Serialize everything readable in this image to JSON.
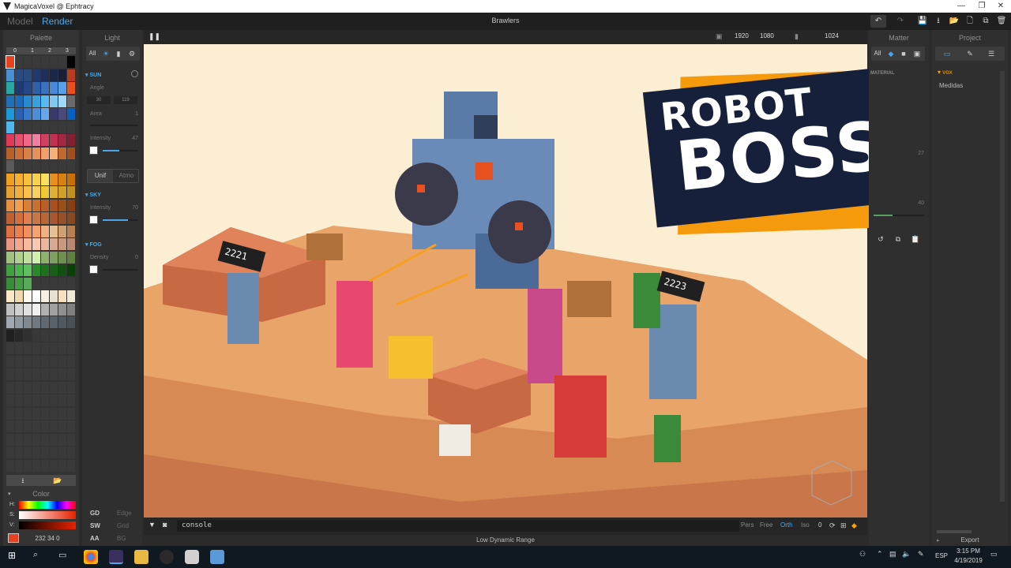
{
  "window": {
    "title": "MagicaVoxel @ Ephtracy",
    "minimize": "—",
    "restore": "❐",
    "close": "✕"
  },
  "modes": {
    "model": "Model",
    "render": "Render"
  },
  "document": {
    "title": "Brawlers"
  },
  "toolbar": {
    "undo": "↶",
    "redo": "↷",
    "save": "💾",
    "export": "⭳",
    "open": "📂",
    "new": "🗋",
    "copy": "⧉",
    "delete": "🗑"
  },
  "palette": {
    "heading": "Palette",
    "pages": [
      "0",
      "1",
      "2",
      "3"
    ],
    "colors": [
      [
        "#e8411f",
        "#3a3a3a",
        "#3a3a3a",
        "#3a3a3a",
        "#3a3a3a",
        "#3a3a3a",
        "#3a3a3a",
        "#050505"
      ],
      [
        "#4a90d0",
        "#2a4b80",
        "#2a4b80",
        "#22386a",
        "#1f2f58",
        "#1b2748",
        "#182038",
        "#b83c22"
      ],
      [
        "#28a8a0",
        "#1f3a70",
        "#27468a",
        "#3060a8",
        "#3a72c0",
        "#4a88d8",
        "#5aa0e8",
        "#e85020"
      ],
      [
        "#2070b8",
        "#1f6ab8",
        "#2a88d0",
        "#3aa0e0",
        "#58b8f0",
        "#80c8f0",
        "#a0d8f8",
        "#6a6a6a"
      ],
      [
        "#1a9ad8",
        "#2a60b0",
        "#3878c8",
        "#4a90d8",
        "#68a8e8",
        "#3a3a6a",
        "#4a4a7a",
        "#0a60c0"
      ],
      [
        "#50b8e8",
        "#3a3a3a",
        "#3a3a3a",
        "#3a3a3a",
        "#3a3a3a",
        "#3a3a3a",
        "#3a3a3a",
        "#3a3a3a"
      ],
      [
        "#e03a5a",
        "#e85070",
        "#f06888",
        "#f080a0",
        "#d04060",
        "#c03050",
        "#a02840",
        "#802030"
      ],
      [
        "#b8602a",
        "#c87038",
        "#d88048",
        "#e89058",
        "#f0a068",
        "#f8b078",
        "#c06a30",
        "#a05020"
      ],
      [
        "#5a5a5a",
        "#3a3a3a",
        "#3a3a3a",
        "#3a3a3a",
        "#3a3a3a",
        "#3a3a3a",
        "#3a3a3a",
        "#3a3a3a"
      ],
      [
        "#f0a020",
        "#f8b030",
        "#f8c040",
        "#f8d050",
        "#f8e060",
        "#e89018",
        "#d88010",
        "#c87008"
      ],
      [
        "#e8a030",
        "#f0b040",
        "#f8c050",
        "#f8d060",
        "#f0c838",
        "#e0b030",
        "#d0a028",
        "#c09020"
      ],
      [
        "#e89040",
        "#f0a050",
        "#d88038",
        "#c87030",
        "#b86028",
        "#a85020",
        "#985018",
        "#884010"
      ],
      [
        "#c06030",
        "#d07040",
        "#e08050",
        "#c87848",
        "#b86838",
        "#a85830",
        "#985028",
        "#884820"
      ],
      [
        "#e07040",
        "#e88050",
        "#f09060",
        "#f8a070",
        "#f0b080",
        "#e8c090",
        "#d0a070",
        "#b88050"
      ],
      [
        "#e89880",
        "#f0a890",
        "#f8b8a0",
        "#f8c8b0",
        "#e8b8a0",
        "#d8a890",
        "#c89880",
        "#b88870"
      ],
      [
        "#a0c080",
        "#b0d090",
        "#c0e0a0",
        "#d0f0b0",
        "#90b070",
        "#80a060",
        "#709050",
        "#608040"
      ],
      [
        "#40a040",
        "#50b050",
        "#60c060",
        "#2a8a2a",
        "#207020",
        "#186018",
        "#105010",
        "#084008"
      ],
      [
        "#3a8a3a",
        "#4a9a4a",
        "#5aaa5a",
        "#3a3a3a",
        "#3a3a3a",
        "#3a3a3a",
        "#3a3a3a",
        "#3a3a3a"
      ],
      [
        "#f8e8c8",
        "#f0d8b0",
        "#fff8f0",
        "#ffffff",
        "#f8f0e0",
        "#e8e0d0",
        "#f8e0c0",
        "#f0e8d8"
      ],
      [
        "#c0c0c0",
        "#d0d0d0",
        "#e0e0e0",
        "#f0f0f0",
        "#b0b0b0",
        "#a0a0a0",
        "#909090",
        "#808080"
      ],
      [
        "#a0a8b0",
        "#9098a0",
        "#808890",
        "#707880",
        "#606870",
        "#586068",
        "#505860",
        "#485058"
      ],
      [
        "#202020",
        "#282828",
        "#303030",
        "#383838",
        "#3a3a3a",
        "#3a3a3a",
        "#3a3a3a",
        "#3a3a3a"
      ],
      [
        "#3a3a3a",
        "#3a3a3a",
        "#3a3a3a",
        "#3a3a3a",
        "#3a3a3a",
        "#3a3a3a",
        "#3a3a3a",
        "#3a3a3a"
      ],
      [
        "#3a3a3a",
        "#3a3a3a",
        "#3a3a3a",
        "#3a3a3a",
        "#3a3a3a",
        "#3a3a3a",
        "#3a3a3a",
        "#3a3a3a"
      ],
      [
        "#3a3a3a",
        "#3a3a3a",
        "#3a3a3a",
        "#3a3a3a",
        "#3a3a3a",
        "#3a3a3a",
        "#3a3a3a",
        "#3a3a3a"
      ],
      [
        "#3a3a3a",
        "#3a3a3a",
        "#3a3a3a",
        "#3a3a3a",
        "#3a3a3a",
        "#3a3a3a",
        "#3a3a3a",
        "#3a3a3a"
      ],
      [
        "#3a3a3a",
        "#3a3a3a",
        "#3a3a3a",
        "#3a3a3a",
        "#3a3a3a",
        "#3a3a3a",
        "#3a3a3a",
        "#3a3a3a"
      ],
      [
        "#3a3a3a",
        "#3a3a3a",
        "#3a3a3a",
        "#3a3a3a",
        "#3a3a3a",
        "#3a3a3a",
        "#3a3a3a",
        "#3a3a3a"
      ],
      [
        "#3a3a3a",
        "#3a3a3a",
        "#3a3a3a",
        "#3a3a3a",
        "#3a3a3a",
        "#3a3a3a",
        "#3a3a3a",
        "#3a3a3a"
      ],
      [
        "#3a3a3a",
        "#3a3a3a",
        "#3a3a3a",
        "#3a3a3a",
        "#3a3a3a",
        "#3a3a3a",
        "#3a3a3a",
        "#3a3a3a"
      ],
      [
        "#3a3a3a",
        "#3a3a3a",
        "#3a3a3a",
        "#3a3a3a",
        "#3a3a3a",
        "#3a3a3a",
        "#3a3a3a",
        "#3a3a3a"
      ],
      [
        "#3a3a3a",
        "#3a3a3a",
        "#3a3a3a",
        "#3a3a3a",
        "#3a3a3a",
        "#3a3a3a",
        "#3a3a3a",
        "#3a3a3a"
      ]
    ],
    "color_heading": "Color",
    "h_label": "H:",
    "s_label": "S:",
    "v_label": "V:",
    "current_color": "#e8411f",
    "rgb_value": "232 34 0"
  },
  "light": {
    "heading": "Light",
    "filter_all": "All",
    "sun": {
      "label": "SUN",
      "angle_label": "Angle",
      "angle_a": "30",
      "angle_b": "119",
      "area_label": "Area",
      "area_value": "1",
      "intensity_label": "Intensity",
      "intensity_value": "47",
      "intensity_level": 0.47
    },
    "mode_unif": "Unif",
    "mode_atmo": "Atmo",
    "sky": {
      "label": "SKY",
      "intensity_label": "Intensity",
      "intensity_value": "70",
      "intensity_level": 0.7
    },
    "fog": {
      "label": "FOG",
      "density_label": "Density",
      "density_value": "0"
    },
    "toggles": [
      {
        "a": "GD",
        "b": "Edge"
      },
      {
        "a": "SW",
        "b": "Grid"
      },
      {
        "a": "AA",
        "b": "BG"
      }
    ]
  },
  "viewport": {
    "res_w": "1920",
    "res_h": "1080",
    "samples": "1024",
    "console_label": "console",
    "view_modes": [
      "Pers",
      "Free",
      "Orth",
      "Iso"
    ],
    "active_view": "Orth",
    "view_zero": "0",
    "status": "Low Dynamic Range",
    "banner_line1": "ROBOT",
    "banner_line2": "BOSS",
    "sign_text": "2221",
    "sign_text2": "2223"
  },
  "matter": {
    "heading": "Matter",
    "filter_all": "All",
    "material_label": "MATERIAL",
    "val_a": "27",
    "val_b": "40"
  },
  "project": {
    "heading": "Project",
    "folder": "vox",
    "items": [
      "Medidas"
    ],
    "export_label": "Export"
  },
  "taskbar": {
    "lang": "ESP",
    "time": "3:15 PM",
    "date": "4/19/2019"
  },
  "colors": {
    "accent": "#4ba8e8",
    "banner_orange": "#f59a0c",
    "banner_navy": "#17203a",
    "sand": "#fbeed2"
  }
}
